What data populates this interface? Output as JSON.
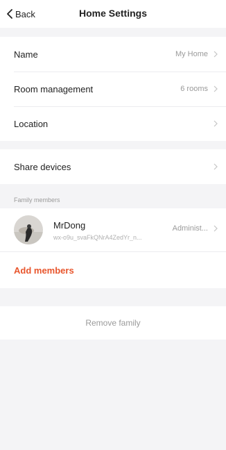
{
  "nav": {
    "back_label": "Back",
    "title": "Home Settings"
  },
  "settings": [
    {
      "label": "Name",
      "value": "My Home"
    },
    {
      "label": "Room management",
      "value": "6 rooms"
    },
    {
      "label": "Location",
      "value": ""
    }
  ],
  "share": {
    "label": "Share devices"
  },
  "family": {
    "section_label": "Family members",
    "members": [
      {
        "name": "MrDong",
        "id": "wx-o9u_svaFkQNrA4ZedYr_n...",
        "role": "Administ..."
      }
    ],
    "add_label": "Add members"
  },
  "remove_label": "Remove family",
  "colors": {
    "accent": "#e8552c",
    "muted": "#9a9a9a",
    "background": "#f4f4f6"
  }
}
